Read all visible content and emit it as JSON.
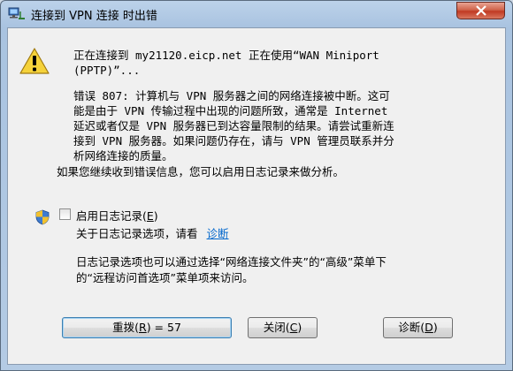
{
  "window": {
    "title": "连接到 VPN 连接 时出错"
  },
  "message": {
    "connecting_line1": "正在连接到 my21120.eicp.net 正在使用“WAN Miniport",
    "connecting_line2": "(PPTP)”...",
    "error_line1": "错误 807: 计算机与 VPN 服务器之间的网络连接被中断。这可",
    "error_line2": "能是由于 VPN 传输过程中出现的问题所致，通常是 Internet",
    "error_line3": "延迟或者仅是 VPN 服务器已到达容量限制的结果。请尝试重新连",
    "error_line4": "接到 VPN 服务器。如果问题仍存在，请与 VPN 管理员联系并分",
    "error_line5": "析网络连接的质量。",
    "hint": "如果您继续收到错误信息，您可以启用日志记录来做分析。"
  },
  "logging": {
    "checkbox_label": "启用日志记录(",
    "checkbox_key": "E",
    "checkbox_label_end": ")",
    "info_text": "关于日志记录选项，请看",
    "info_link": "诊断",
    "note_line1": "日志记录选项也可以通过选择“网络连接文件夹”的“高级”菜单下",
    "note_line2": "的“远程访问首选项”菜单项来访问。"
  },
  "buttons": {
    "redial_pre": "重拨(",
    "redial_key": "R",
    "redial_post": ") = 57",
    "close_pre": "关闭(",
    "close_key": "C",
    "close_post": ")",
    "diagnose_pre": "诊断(",
    "diagnose_key": "D",
    "diagnose_post": ")"
  },
  "icons": {
    "title": "network-connection-icon",
    "warning": "warning-icon",
    "shield": "uac-shield-icon",
    "close": "close-icon"
  },
  "colors": {
    "link": "#0066cc",
    "close_button": "#c03a23",
    "warning_yellow": "#f5d23a"
  }
}
